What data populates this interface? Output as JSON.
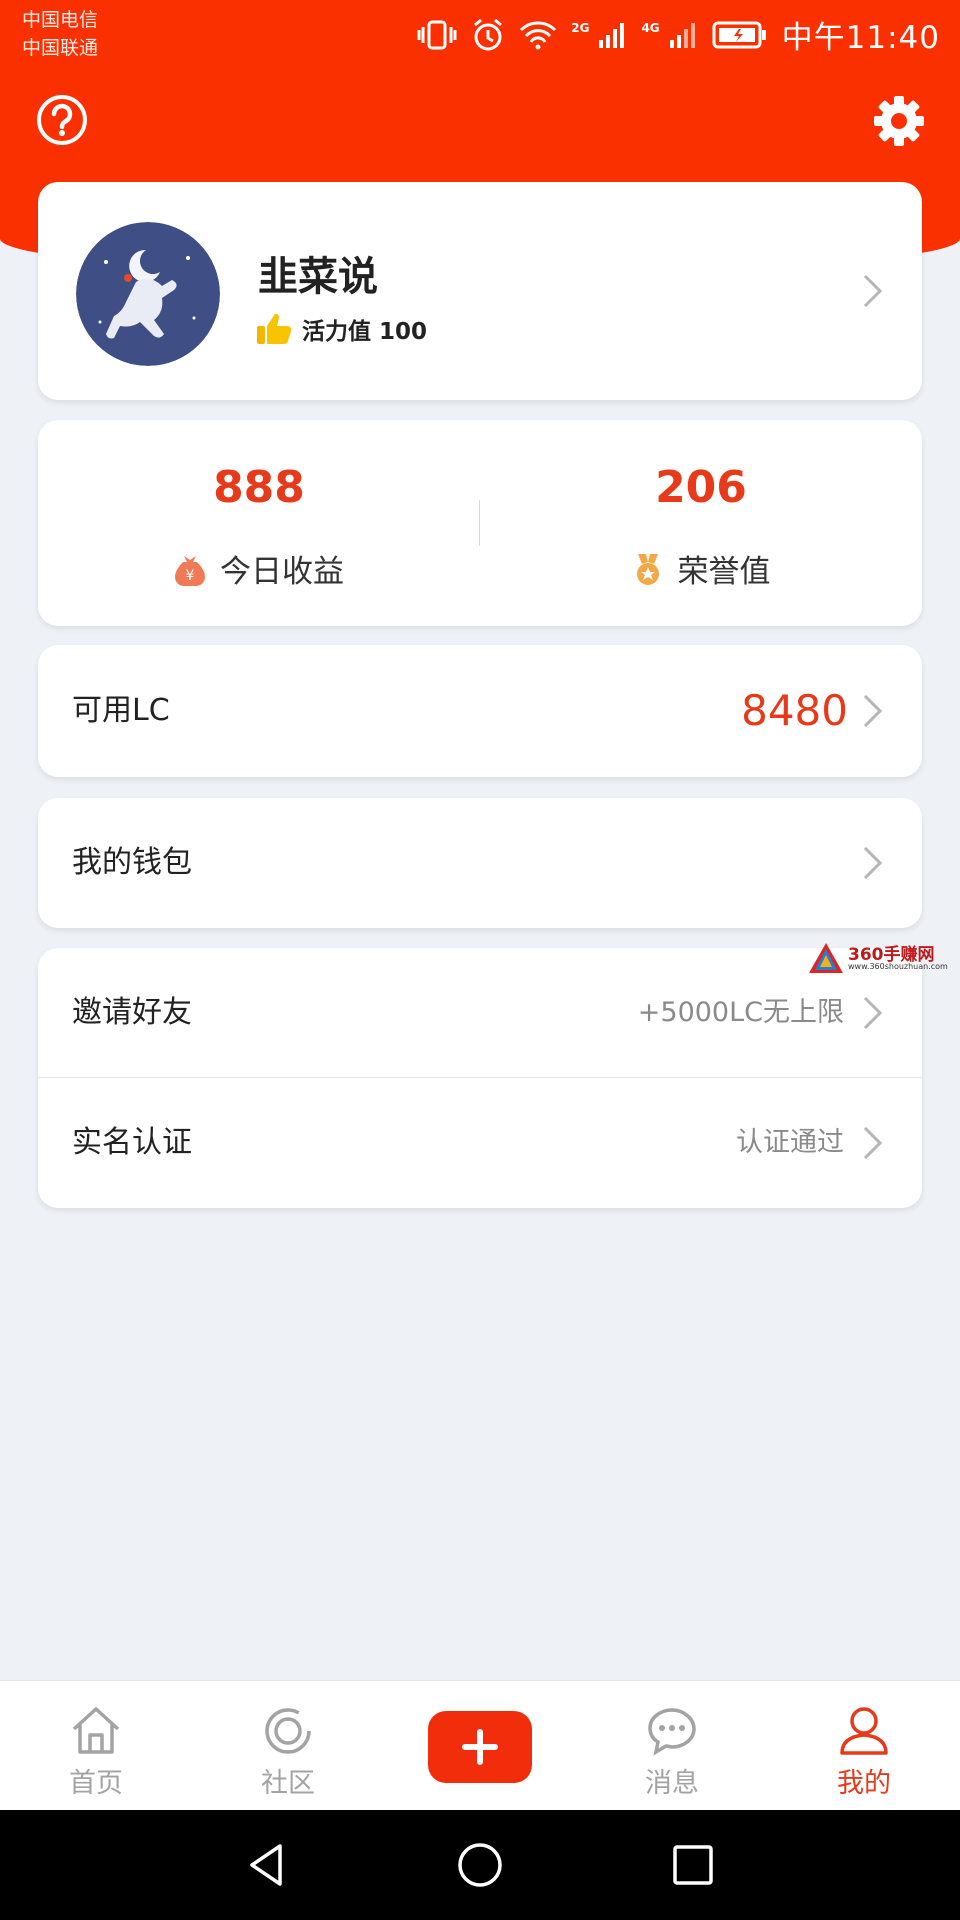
{
  "status_bar": {
    "carrier_1": "中国电信",
    "carrier_2": "中国联通",
    "net_1": "2G",
    "net_2": "4G",
    "time": "中午11:40",
    "icons": [
      "vibrate-icon",
      "alarm-icon",
      "wifi-icon",
      "signal-icon",
      "battery-icon"
    ]
  },
  "header": {
    "help_icon": "question-circle-icon",
    "settings_icon": "gear-icon",
    "accent_color": "#fa3000"
  },
  "profile": {
    "username": "韭菜说",
    "vitality": "活力值 100",
    "avatar_icon": "astronaut-avatar"
  },
  "stats": {
    "today_earnings_value": "888",
    "today_earnings_label": "今日收益",
    "honor_value": "206",
    "honor_label": "荣誉值"
  },
  "available_lc": {
    "label": "可用LC",
    "value": "8480"
  },
  "wallet": {
    "label": "我的钱包"
  },
  "invite": {
    "label": "邀请好友",
    "value": "+5000LC无上限"
  },
  "verification": {
    "label": "实名认证",
    "value": "认证通过"
  },
  "watermark": {
    "text": "360手赚网",
    "url": "www.360shouzhuan.com"
  },
  "tabbar": {
    "home": "首页",
    "community": "社区",
    "messages": "消息",
    "mine": "我的",
    "active": "mine"
  }
}
